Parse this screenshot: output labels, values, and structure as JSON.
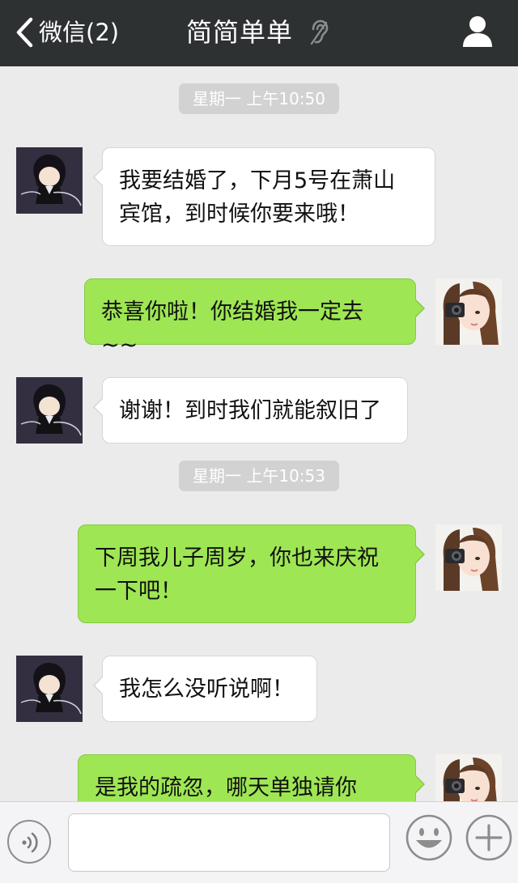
{
  "header": {
    "back_label": "微信(2)",
    "title": "简简单单",
    "icons": {
      "back": "chevron-left-icon",
      "ear": "ear-icon",
      "profile": "person-icon"
    }
  },
  "timestamps": [
    "星期一 上午10:50",
    "星期一 上午10:53"
  ],
  "messages": [
    {
      "from": "friend",
      "text": "我要结婚了，下月5号在萧山宾馆，到时候你要来哦！",
      "lines": [
        "我要结婚了，下月5号在萧山",
        "宾馆，到时候你要来哦！"
      ]
    },
    {
      "from": "me",
      "text": "恭喜你啦！你结婚我一定去~~",
      "lines": [
        "恭喜你啦！你结婚我一定去~~"
      ]
    },
    {
      "from": "friend",
      "text": "谢谢！到时我们就能叙旧了",
      "lines": [
        "谢谢！到时我们就能叙旧了"
      ]
    },
    {
      "from": "me",
      "text": "下周我儿子周岁，你也来庆祝一下吧！",
      "lines": [
        "下周我儿子周岁，你也来庆祝",
        "一下吧！"
      ]
    },
    {
      "from": "friend",
      "text": "我怎么没听说啊！",
      "lines": [
        "我怎么没听说啊！"
      ]
    },
    {
      "from": "me",
      "text": "是我的疏忽，哪天单独请你",
      "lines": [
        "是我的疏忽，哪天单独请你"
      ]
    }
  ],
  "input_bar": {
    "text_value": "",
    "icons": {
      "voice": "voice-icon",
      "emoji": "smiley-icon",
      "more": "plus-icon"
    }
  },
  "colors": {
    "header_bg": "#2e3132",
    "chat_bg": "#ebebeb",
    "outgoing_bubble": "#9ee653",
    "incoming_bubble": "#ffffff",
    "timestamp_bg": "#d2d2d2"
  }
}
